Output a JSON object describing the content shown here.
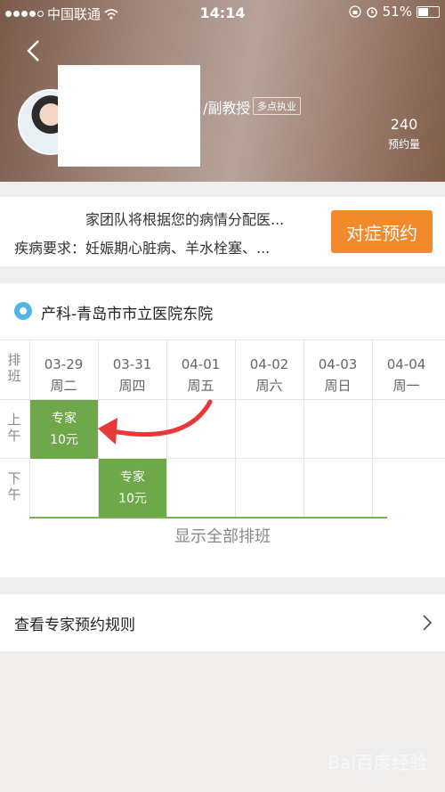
{
  "status": {
    "carrier": "中国联通",
    "time": "14:14",
    "battery": "51%",
    "battery_level": 0.51
  },
  "doctor": {
    "title_suffix": "/副教授",
    "badge": "多点执业",
    "booking_count": "240",
    "booking_count_label": "预约量"
  },
  "team": {
    "line1": "家团队将根据您的病情分配医...",
    "line2": "疾病要求：妊娠期心脏病、羊水栓塞、...",
    "button": "对症预约"
  },
  "schedule": {
    "location": "产科-青岛市市立医院东院",
    "row_header": "排班",
    "rows": [
      "上午",
      "下午"
    ],
    "columns": [
      {
        "date": "03-29",
        "weekday": "周二"
      },
      {
        "date": "03-31",
        "weekday": "周四"
      },
      {
        "date": "04-01",
        "weekday": "周五"
      },
      {
        "date": "04-02",
        "weekday": "周六"
      },
      {
        "date": "04-03",
        "weekday": "周日"
      },
      {
        "date": "04-04",
        "weekday": "周一"
      }
    ],
    "slots": [
      {
        "type": "专家",
        "price": "10元"
      },
      {
        "type": "专家",
        "price": "10元"
      }
    ],
    "show_all": "显示全部排班"
  },
  "rules": {
    "label": "查看专家预约规则"
  },
  "watermark": "Bai百度经验"
}
